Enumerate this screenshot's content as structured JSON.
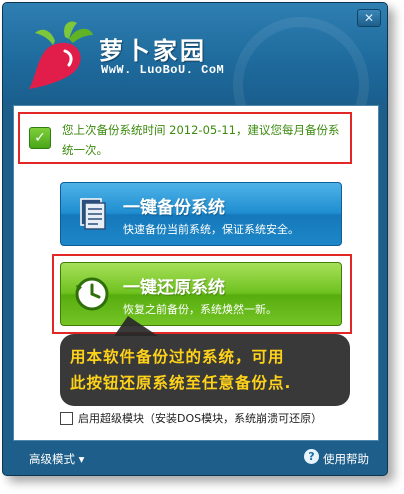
{
  "window": {
    "app_name": "萝卜家园",
    "app_url": "WwW. LuoBoU. CoM",
    "close_glyph": "✕"
  },
  "notice": {
    "check_glyph": "✓",
    "text": "您上次备份系统时间 2012-05-11，建议您每月备份系统一次。"
  },
  "backup": {
    "title": "一键备份系统",
    "subtitle": "快速备份当前系统，保证系统安全。",
    "icon": "document-icon"
  },
  "restore": {
    "title": "一键还原系统",
    "subtitle": "恢复之前备份，系统焕然一新。",
    "icon": "clock-restore-icon"
  },
  "tooltip": {
    "line1": "用本软件备份过的系统，可用",
    "line2": "此按钮还原系统至任意备份点."
  },
  "option": {
    "label": "启用超级模块（安装DOS模块，系统崩溃可还原）",
    "checked": false
  },
  "footer": {
    "advanced_label": "高级模式 ▾",
    "help_label": "使用帮助",
    "help_glyph": "?"
  },
  "colors": {
    "accent_blue": "#1f8ed0",
    "accent_green": "#6fc21f",
    "highlight_red": "#e32727",
    "tooltip_text": "#ffd21a"
  }
}
